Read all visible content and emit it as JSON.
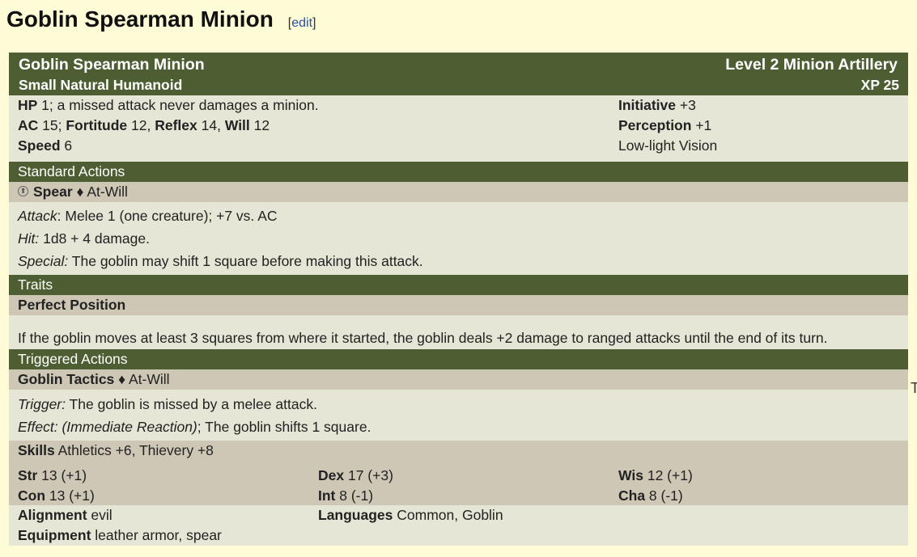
{
  "page": {
    "title": "Goblin Spearman Minion",
    "edit_open": "[",
    "edit_label": "edit",
    "edit_close": "]"
  },
  "statblock": {
    "name": "Goblin Spearman Minion",
    "level": "Level 2 Minion Artillery",
    "type": "Small Natural Humanoid",
    "xp": "XP 25",
    "hp_label": "HP",
    "hp_value": " 1; a missed attack never damages a minion.",
    "ac_label": "AC",
    "ac_value": " 15; ",
    "fort_label": "Fortitude",
    "fort_value": " 12, ",
    "ref_label": "Reflex",
    "ref_value": " 14, ",
    "will_label": "Will",
    "will_value": " 12",
    "speed_label": "Speed",
    "speed_value": " 6",
    "init_label": "Initiative",
    "init_value": " +3",
    "perc_label": "Perception",
    "perc_value": " +1",
    "vision": "Low-light Vision"
  },
  "standard_actions": {
    "heading": "Standard Actions",
    "power_icon": "melee-basic-attack-icon",
    "power_icon_glyph": "⬆",
    "power_name": "Spear",
    "power_sep": " ♦ ",
    "power_usage": "At-Will",
    "attack_label": "Attack",
    "attack_text": ": Melee 1 (one creature); +7 vs. AC",
    "hit_label": "Hit:",
    "hit_text": " 1d8 + 4 damage.",
    "special_label": "Special:",
    "special_text": " The goblin may shift 1 square before making this attack."
  },
  "traits": {
    "heading": "Traits",
    "trait_name": "Perfect Position",
    "trait_text": "If the goblin moves at least 3 squares from where it started, the goblin deals +2 damage to ranged attacks until the end of its turn."
  },
  "triggered_actions": {
    "heading": "Triggered Actions",
    "power_name": "Goblin Tactics",
    "power_sep": " ♦ ",
    "power_usage": "At-Will",
    "trigger_label": "Trigger:",
    "trigger_text": " The goblin is missed by a melee attack.",
    "effect_label": "Effect:",
    "effect_italic": " (Immediate Reaction)",
    "effect_text": "; The goblin shifts 1 square."
  },
  "abilities": {
    "skills_label": "Skills",
    "skills_value": " Athletics +6, Thievery +8",
    "str_label": "Str",
    "str_value": " 13 (+1)",
    "dex_label": "Dex",
    "dex_value": " 17 (+3)",
    "wis_label": "Wis",
    "wis_value": " 12 (+1)",
    "con_label": "Con",
    "con_value": " 13 (+1)",
    "int_label": "Int",
    "int_value": " 8 (-1)",
    "cha_label": "Cha",
    "cha_value": " 8 (-1)",
    "alignment_label": "Alignment",
    "alignment_value": " evil",
    "languages_label": "Languages",
    "languages_value": " Common, Goblin",
    "equipment_label": "Equipment",
    "equipment_value": " leather armor, spear"
  },
  "edge_glyph": "T"
}
